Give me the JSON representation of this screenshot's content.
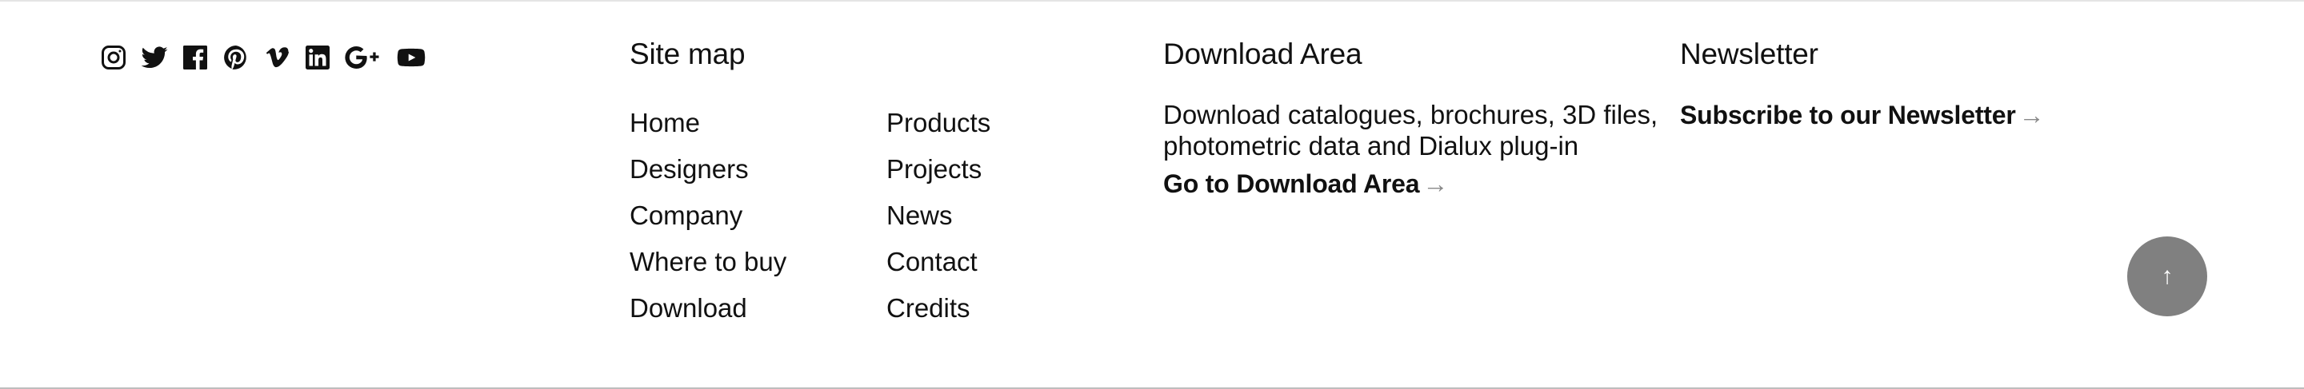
{
  "social": {
    "icons": [
      "instagram-icon",
      "twitter-icon",
      "facebook-icon",
      "pinterest-icon",
      "vimeo-icon",
      "linkedin-icon",
      "google-plus-icon",
      "youtube-icon"
    ]
  },
  "sitemap": {
    "title": "Site map",
    "col1": [
      "Home",
      "Designers",
      "Company",
      "Where to buy",
      "Download"
    ],
    "col2": [
      "Products",
      "Projects",
      "News",
      "Contact",
      "Credits"
    ]
  },
  "download": {
    "title": "Download Area",
    "description": "Download catalogues, brochures, 3D files, photometric data and Dialux plug-in",
    "link_label": "Go to Download Area",
    "arrow": "→"
  },
  "newsletter": {
    "title": "Newsletter",
    "link_label": "Subscribe to our Newsletter",
    "arrow": "→"
  },
  "scroll_top": {
    "glyph": "↑",
    "color": "#808080"
  }
}
